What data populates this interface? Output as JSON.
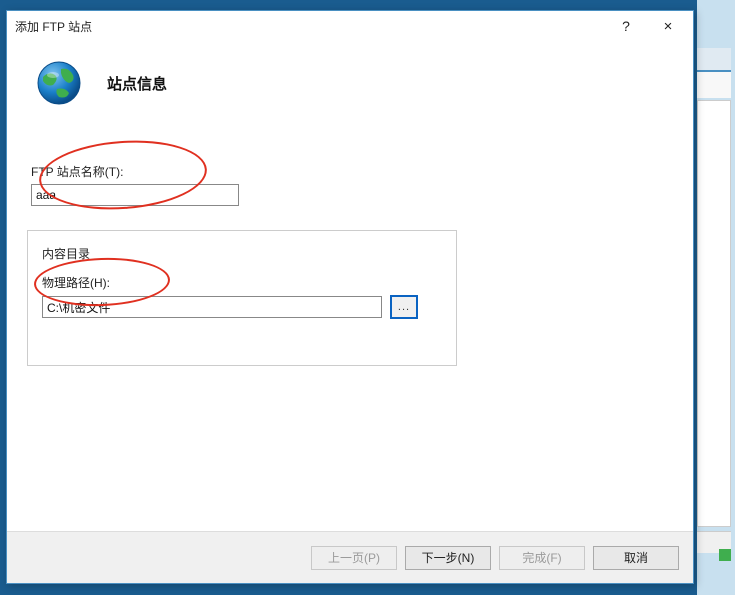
{
  "dialog": {
    "title": "添加 FTP 站点",
    "help_symbol": "?",
    "close_symbol": "×"
  },
  "header": {
    "heading": "站点信息"
  },
  "form": {
    "site_name_label": "FTP 站点名称(T):",
    "site_name_value": "aaa",
    "content_group_label": "内容目录",
    "physical_path_label": "物理路径(H):",
    "physical_path_value": "C:\\机密文件",
    "browse_label": "..."
  },
  "buttons": {
    "prev": "上一页(P)",
    "next": "下一步(N)",
    "finish": "完成(F)",
    "cancel": "取消"
  }
}
